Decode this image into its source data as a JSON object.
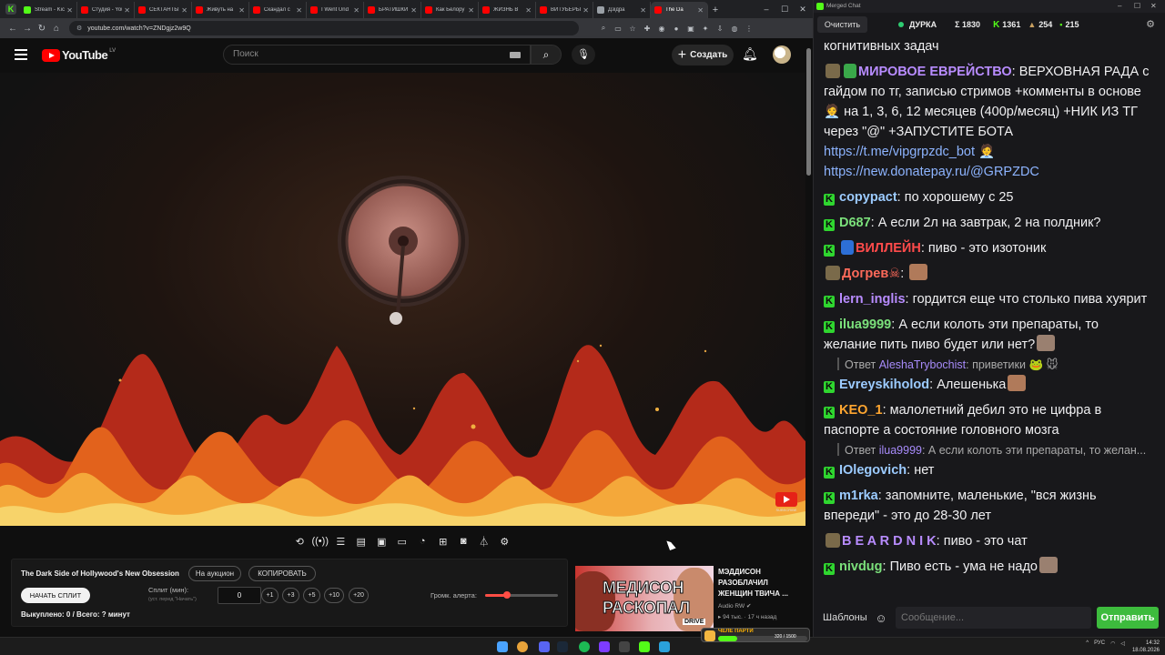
{
  "browser": {
    "tabs": [
      {
        "title": "Stream - Kick",
        "color": "#53fc18"
      },
      {
        "title": "Студия - YouTube",
        "color": "#ff0000"
      },
      {
        "title": "СЕКТАНТЫ",
        "color": "#ff0000"
      },
      {
        "title": "Живуть на",
        "color": "#ff0000"
      },
      {
        "title": "Скандал с",
        "color": "#ff0000"
      },
      {
        "title": "I Went Und",
        "color": "#ff0000"
      },
      {
        "title": "БРАТИШКИ",
        "color": "#ff0000"
      },
      {
        "title": "Как Белору",
        "color": "#ff0000"
      },
      {
        "title": "ЖИЗНЬ В",
        "color": "#ff0000"
      },
      {
        "title": "ВИТУБЕРЫ",
        "color": "#ff0000"
      },
      {
        "title": "Дзідра",
        "color": "#9aa0a6"
      },
      {
        "title": "The Da",
        "color": "#ff0000",
        "active": true
      }
    ],
    "url": "youtube.com/watch?v=ZNDgjz2w9Q"
  },
  "youtube": {
    "logo_text": "YouTube",
    "country_code": "LV",
    "search_placeholder": "Поиск",
    "create_label": "Создать"
  },
  "video": {
    "subscribe_badge": "SUBSCRIBE"
  },
  "player_icons": [
    "loop-icon",
    "audio-icon",
    "playlist-icon",
    "clapper-icon",
    "pip-icon",
    "subtitles-icon",
    "speed-icon",
    "add-icon",
    "screenshot-icon",
    "flask-icon",
    "settings-icon"
  ],
  "auction": {
    "title": "The Dark Side of Hollywood's New Obsession",
    "auction_btn": "На аукцион",
    "copy_btn": "КОПИРОВАТЬ",
    "start_split_btn": "НАЧАТЬ СПЛИТ",
    "split_label": "Сплит (мин):",
    "split_hint": "(уст. перед \"Начать\")",
    "split_value": "0",
    "plus_buttons": [
      "+1",
      "+3",
      "+5",
      "+10",
      "+20"
    ],
    "alert_volume_label": "Громк. алерта:",
    "alert_volume_fraction": 0.3,
    "sold_line": "Выкуплено: 0 / Всего: ? минут"
  },
  "recommended": {
    "thumb_line1": "МЕДИСОН",
    "thumb_line2": "РАСКОПАЛ",
    "thumb_brand": "DRIVE",
    "title": "МЭДДИСОН РАЗОБЛАЧИЛ ЖЕНЩИН ТВИЧА ...",
    "channel": "Audio RW",
    "meta": "94 тыс. · 17 ч назад"
  },
  "chat": {
    "window_title": "Merged Chat",
    "clear_btn": "Очистить",
    "streamer": "ДУРКА",
    "stat_total": "Σ 1830",
    "stat_kick": "1361",
    "stat_twitch": "254",
    "stat_yt": "215",
    "messages": [
      {
        "badges": [],
        "nick": "",
        "color": "#efeff1",
        "text": "когнитивных задач"
      },
      {
        "badges": [
          "tw",
          "check"
        ],
        "nick": "МИРОВОЕ ЕВРЕЙСТВО",
        "color": "#b88cff",
        "text": "ВЕРХОВНАЯ РАДА с гайдом по тг, записью стримов +комменты в основе 🧑‍💼 на 1, 3, 6, 12 месяцев (400р/месяц) +НИК ИЗ ТГ через \"@\" +ЗАПУСТИТЕ БОТА",
        "links": [
          "https://t.me/vipgrpzdc_bot 🧑‍💼",
          "https://new.donatepay.ru/@GRPZDC"
        ]
      },
      {
        "badges": [
          "k"
        ],
        "nick": "copypact",
        "color": "#9ccbff",
        "text": "по хорошему с 25"
      },
      {
        "badges": [
          "k"
        ],
        "nick": "D687",
        "color": "#7be07b",
        "text": "А если 2л на завтрак, 2 на полдник?"
      },
      {
        "badges": [
          "k",
          "mod"
        ],
        "nick": "ВИЛЛЕЙН",
        "color": "#ff4b4b",
        "text": "пиво - это изотоник"
      },
      {
        "badges": [
          "tw"
        ],
        "nick": "Догрев☠",
        "color": "#ff6a5a",
        "text": "",
        "emote": true
      },
      {
        "badges": [
          "k"
        ],
        "nick": "lern_inglis",
        "color": "#b88cff",
        "text": "гордится еще что столько пива хуярит"
      },
      {
        "badges": [
          "k"
        ],
        "nick": "ilua9999",
        "color": "#7be07b",
        "text": "А если колоть эти препараты, то желание пить пиво будет или нет?",
        "emote": true
      },
      {
        "reply_prefix": "Ответ",
        "reply_nick": "AleshaTrybochist",
        "reply_text": "приветики 🐸 🐭"
      },
      {
        "badges": [
          "k"
        ],
        "nick": "Evreyskiholod",
        "color": "#9ccbff",
        "text": "Алешенька",
        "emote": true
      },
      {
        "badges": [
          "k"
        ],
        "nick": "KEO_1",
        "color": "#ffa630",
        "text": "малолетний дебил это не цифра в паспорте а состояние головного мозга"
      },
      {
        "reply_prefix": "Ответ",
        "reply_nick": "ilua9999",
        "reply_text": "А если колоть эти препараты, то желан..."
      },
      {
        "badges": [
          "k"
        ],
        "nick": "IOlegovich",
        "color": "#9ccbff",
        "text": "нет"
      },
      {
        "badges": [
          "k"
        ],
        "nick": "m1rka",
        "color": "#9ccbff",
        "text": "запомните, маленькие, \"вся жизнь впереди\" - это до 28-30 лет"
      },
      {
        "badges": [
          "tw"
        ],
        "nick": "B E A R D N I K",
        "color": "#b88cff",
        "text": "пиво - это чат"
      },
      {
        "badges": [
          "k"
        ],
        "nick": "nivdug",
        "color": "#7be07b",
        "text": "Пиво есть - ума не надо",
        "emote": true
      }
    ],
    "templates_btn": "Шаблоны",
    "input_placeholder": "Сообщение...",
    "send_btn": "Отправить"
  },
  "kick_goal": {
    "label": "ЧЕЛЕ ПАРТИ",
    "count": "320 / 1500",
    "fraction": 0.21
  },
  "taskbar": {
    "lang": "РУС",
    "time": "14:32",
    "date": "18.08.2026"
  },
  "colors": {
    "yt_red": "#ff0000",
    "kick_green": "#53fc18",
    "send_green": "#3dbb3d"
  }
}
